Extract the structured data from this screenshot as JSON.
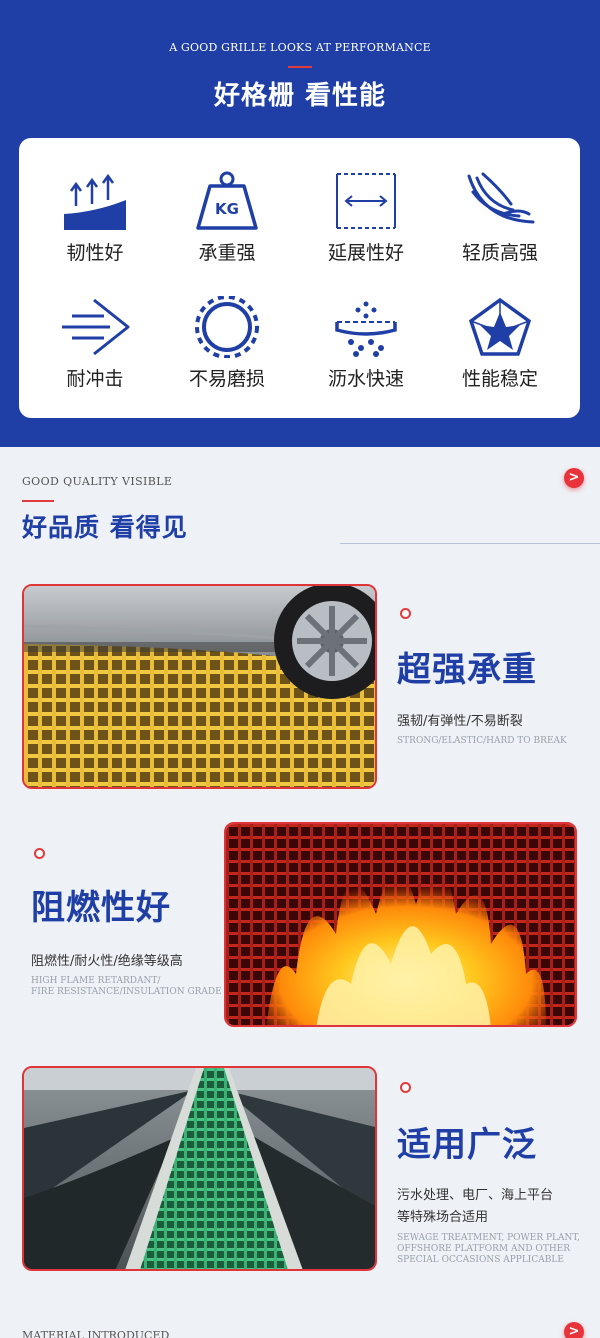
{
  "hero": {
    "subtitle_en": "A GOOD GRILLE LOOKS AT PERFORMANCE",
    "title_cn": "好格栅 看性能"
  },
  "features": [
    {
      "icon": "toughness-arrows-icon",
      "label": "韧性好"
    },
    {
      "icon": "kg-weight-icon",
      "label": "承重强"
    },
    {
      "icon": "ductility-arrow-icon",
      "label": "延展性好"
    },
    {
      "icon": "feather-icon",
      "label": "轻质高强"
    },
    {
      "icon": "impact-arrow-icon",
      "label": "耐冲击"
    },
    {
      "icon": "wear-ring-icon",
      "label": "不易磨损"
    },
    {
      "icon": "drainage-icon",
      "label": "沥水快速"
    },
    {
      "icon": "pentagon-star-icon",
      "label": "性能稳定"
    }
  ],
  "quality": {
    "subtitle_en": "GOOD QUALITY VISIBLE",
    "title_cn": "好品质 看得见",
    "more_glyph": ">"
  },
  "blocks": [
    {
      "title": "超强承重",
      "sub": "强韧/有弹性/不易断裂",
      "en": [
        "STRONG/ELASTIC/HARD TO BREAK"
      ]
    },
    {
      "title": "阻燃性好",
      "sub": "阻燃性/耐火性/绝缘等级高",
      "en": [
        "HIGH FLAME RETARDANT/",
        "FIRE RESISTANCE/INSULATION GRADE"
      ]
    },
    {
      "title": "适用广泛",
      "sub": "污水处理、电厂、海上平台",
      "sub2": "等特殊场合适用",
      "en": [
        "SEWAGE TREATMENT, POWER PLANT,",
        "OFFSHORE PLATFORM AND OTHER",
        "SPECIAL OCCASIONS APPLICABLE"
      ]
    }
  ],
  "material": {
    "subtitle_en": "MATERIAL INTRODUCED",
    "more_glyph": ">"
  },
  "colors": {
    "brand_blue": "#1f3fa6",
    "accent_red": "#e23b3b",
    "grating_yellow": "#e8b92a",
    "grating_green": "#2fa86a"
  }
}
